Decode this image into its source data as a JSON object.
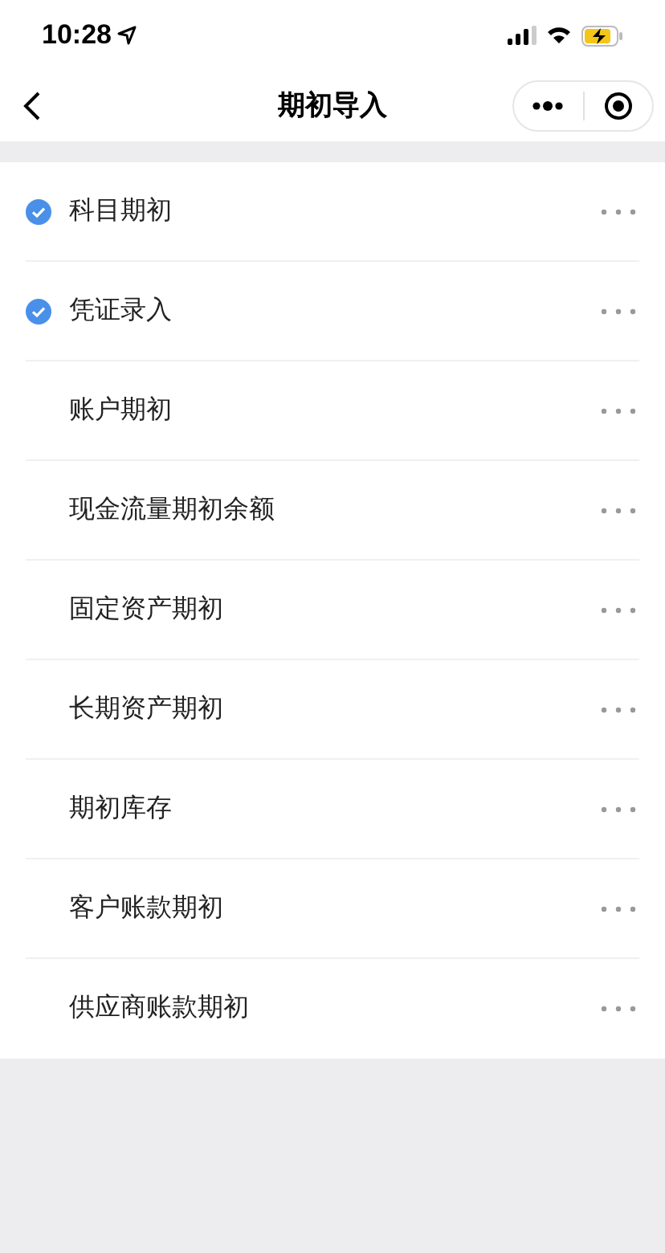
{
  "status_bar": {
    "time": "10:28"
  },
  "header": {
    "title": "期初导入"
  },
  "items": [
    {
      "label": "科目期初",
      "checked": true
    },
    {
      "label": "凭证录入",
      "checked": true
    },
    {
      "label": "账户期初",
      "checked": false
    },
    {
      "label": "现金流量期初余额",
      "checked": false
    },
    {
      "label": "固定资产期初",
      "checked": false
    },
    {
      "label": "长期资产期初",
      "checked": false
    },
    {
      "label": "期初库存",
      "checked": false
    },
    {
      "label": "客户账款期初",
      "checked": false
    },
    {
      "label": "供应商账款期初",
      "checked": false
    }
  ]
}
